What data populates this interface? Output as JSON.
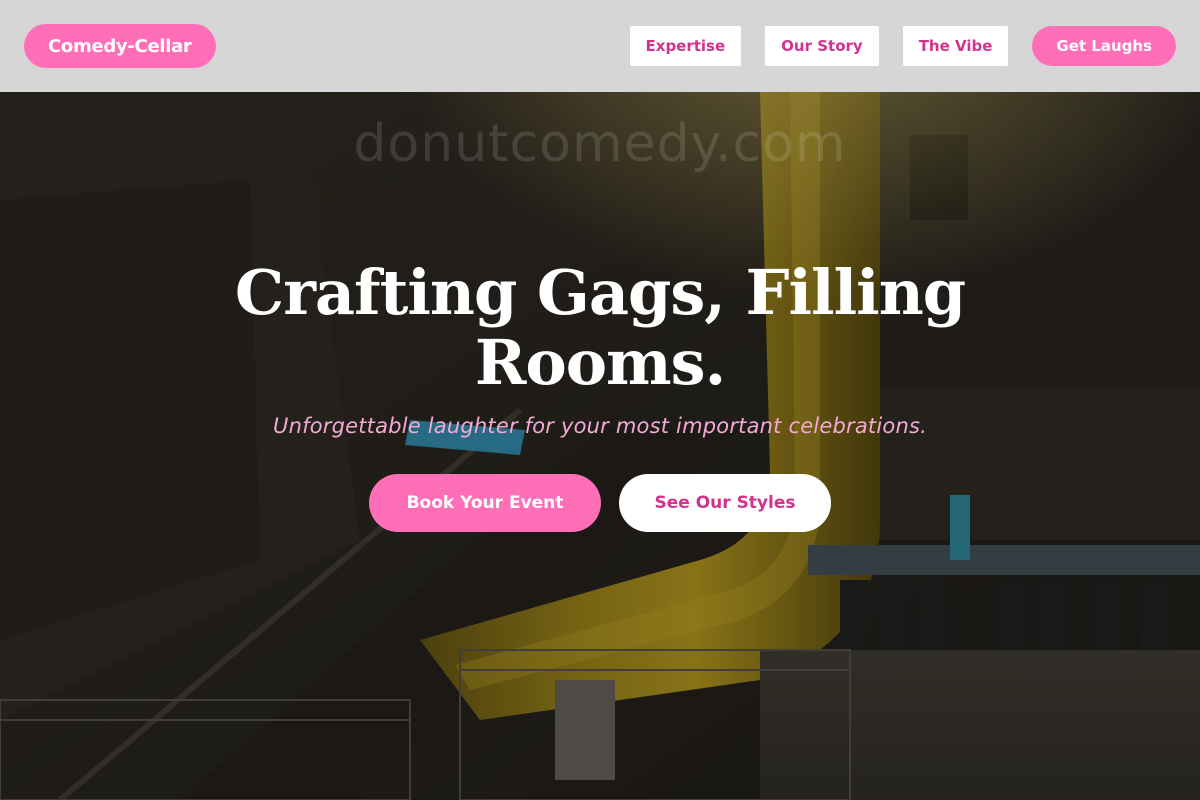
{
  "header": {
    "logo_text": "Comedy-Cellar",
    "nav": [
      {
        "label": "Expertise"
      },
      {
        "label": "Our Story"
      },
      {
        "label": "The Vibe"
      }
    ],
    "cta_label": "Get Laughs"
  },
  "hero": {
    "headline": "Crafting Gags, Filling Rooms.",
    "watermark": "donutcomedy.com",
    "tagline": "Unforgettable laughter for your most important celebrations.",
    "primary_button": "Book Your Event",
    "secondary_button": "See Our Styles",
    "background_icon": "venue-photo"
  },
  "colors": {
    "brand_pink": "#ff6fb8",
    "accent_magenta": "#d1338e",
    "header_bg": "#d6d6d6",
    "tagline_pink": "#f3a9d4"
  }
}
